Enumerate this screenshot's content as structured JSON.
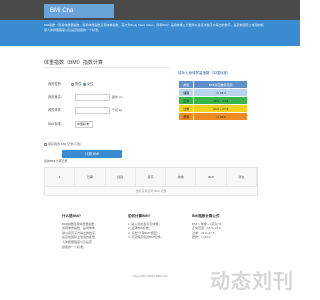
{
  "header": {
    "brand": "BMI Cha"
  },
  "banner": {
    "text": "BMI指数（即身体质量指数，简称体质指数又称体重指数，英文为Body Mass Index，简称BMI）是用体重公斤数除以身高米数平方得出的数字，是目前国际上常用的衡量人体胖瘦程度以及是否健康的一个标准。"
  },
  "form": {
    "title": "体重指数（BMI）指数计算",
    "gender_label": "我的性别:",
    "gender_male": "男性",
    "gender_female": "女性",
    "height_label": "我的身高:",
    "height_unit": "厘米 cm",
    "weight_label": "我的体重:",
    "weight_unit": "千克 kg",
    "standard_label": "BMI 标准:",
    "standard_value": "中国标准",
    "remember_text": "保存我的 BMI 记录(可选)",
    "submit": "计算 BMI"
  },
  "sidebar": {
    "title": "成年人身体质量指数（中国标准）",
    "header_left": "类型",
    "header_right": "BMI对应数值范围",
    "rows": [
      {
        "name": "偏瘦",
        "range": "<= 18.4",
        "color": "#b9d3ec"
      },
      {
        "name": "正常",
        "range": "18.5 ~ 23.9",
        "color": "#39b54a"
      },
      {
        "name": "过重",
        "range": "24.0 ~ 27.9",
        "color": "#f2d01e"
      },
      {
        "name": "肥胖",
        "range": ">= 28.0",
        "color": "#f08a24"
      }
    ]
  },
  "history": {
    "title": "您的BMI计算记录",
    "cols": [
      "#",
      "日期",
      "性别",
      "身高",
      "体重",
      "BMI",
      "状态"
    ],
    "empty": "当前没有任何 BMI 记录"
  },
  "info": [
    {
      "title": "什么是BMI?",
      "lines": [
        "BMI指数即身体质量指数，",
        "简称体质指数，是用体重",
        "除以身高平方得出的数字，",
        "是目前国际上常用的衡量",
        "人体胖瘦程度以及是否",
        "健康的一个标准。"
      ]
    },
    {
      "title": "如何计算BMI?",
      "lines": [
        "1. 输入您的身高与体重；",
        "2. 选择BMI标准；",
        "3. 点击\"计算BMI\"按钮；",
        "4. 可选保存您的BMI记录。"
      ]
    },
    {
      "title": "BMI指数计算公式",
      "lines": [
        "BMI = 体重 ÷ (身高)^2",
        "正常范围：18.5~23.9",
        "过重：24.0~27.9",
        "肥胖：>=28.0"
      ]
    }
  ],
  "footer": "Copyright ©2021 BMI Cha",
  "watermark": "动态刘刊"
}
